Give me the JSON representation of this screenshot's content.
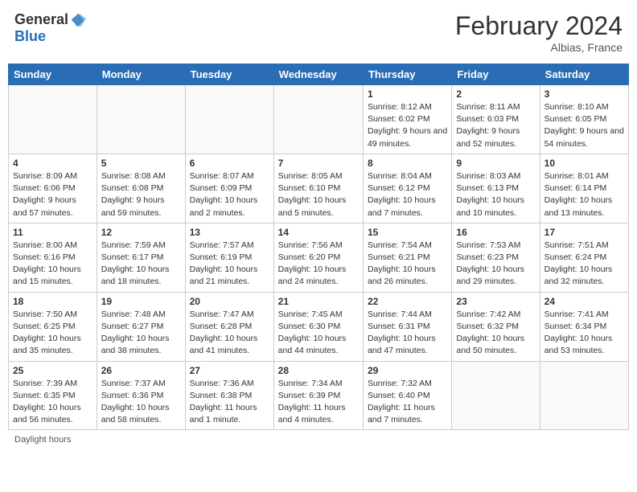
{
  "header": {
    "logo_general": "General",
    "logo_blue": "Blue",
    "month_year": "February 2024",
    "location": "Albias, France"
  },
  "days_of_week": [
    "Sunday",
    "Monday",
    "Tuesday",
    "Wednesday",
    "Thursday",
    "Friday",
    "Saturday"
  ],
  "weeks": [
    [
      {
        "day": "",
        "info": ""
      },
      {
        "day": "",
        "info": ""
      },
      {
        "day": "",
        "info": ""
      },
      {
        "day": "",
        "info": ""
      },
      {
        "day": "1",
        "info": "Sunrise: 8:12 AM\nSunset: 6:02 PM\nDaylight: 9 hours and 49 minutes."
      },
      {
        "day": "2",
        "info": "Sunrise: 8:11 AM\nSunset: 6:03 PM\nDaylight: 9 hours and 52 minutes."
      },
      {
        "day": "3",
        "info": "Sunrise: 8:10 AM\nSunset: 6:05 PM\nDaylight: 9 hours and 54 minutes."
      }
    ],
    [
      {
        "day": "4",
        "info": "Sunrise: 8:09 AM\nSunset: 6:06 PM\nDaylight: 9 hours and 57 minutes."
      },
      {
        "day": "5",
        "info": "Sunrise: 8:08 AM\nSunset: 6:08 PM\nDaylight: 9 hours and 59 minutes."
      },
      {
        "day": "6",
        "info": "Sunrise: 8:07 AM\nSunset: 6:09 PM\nDaylight: 10 hours and 2 minutes."
      },
      {
        "day": "7",
        "info": "Sunrise: 8:05 AM\nSunset: 6:10 PM\nDaylight: 10 hours and 5 minutes."
      },
      {
        "day": "8",
        "info": "Sunrise: 8:04 AM\nSunset: 6:12 PM\nDaylight: 10 hours and 7 minutes."
      },
      {
        "day": "9",
        "info": "Sunrise: 8:03 AM\nSunset: 6:13 PM\nDaylight: 10 hours and 10 minutes."
      },
      {
        "day": "10",
        "info": "Sunrise: 8:01 AM\nSunset: 6:14 PM\nDaylight: 10 hours and 13 minutes."
      }
    ],
    [
      {
        "day": "11",
        "info": "Sunrise: 8:00 AM\nSunset: 6:16 PM\nDaylight: 10 hours and 15 minutes."
      },
      {
        "day": "12",
        "info": "Sunrise: 7:59 AM\nSunset: 6:17 PM\nDaylight: 10 hours and 18 minutes."
      },
      {
        "day": "13",
        "info": "Sunrise: 7:57 AM\nSunset: 6:19 PM\nDaylight: 10 hours and 21 minutes."
      },
      {
        "day": "14",
        "info": "Sunrise: 7:56 AM\nSunset: 6:20 PM\nDaylight: 10 hours and 24 minutes."
      },
      {
        "day": "15",
        "info": "Sunrise: 7:54 AM\nSunset: 6:21 PM\nDaylight: 10 hours and 26 minutes."
      },
      {
        "day": "16",
        "info": "Sunrise: 7:53 AM\nSunset: 6:23 PM\nDaylight: 10 hours and 29 minutes."
      },
      {
        "day": "17",
        "info": "Sunrise: 7:51 AM\nSunset: 6:24 PM\nDaylight: 10 hours and 32 minutes."
      }
    ],
    [
      {
        "day": "18",
        "info": "Sunrise: 7:50 AM\nSunset: 6:25 PM\nDaylight: 10 hours and 35 minutes."
      },
      {
        "day": "19",
        "info": "Sunrise: 7:48 AM\nSunset: 6:27 PM\nDaylight: 10 hours and 38 minutes."
      },
      {
        "day": "20",
        "info": "Sunrise: 7:47 AM\nSunset: 6:28 PM\nDaylight: 10 hours and 41 minutes."
      },
      {
        "day": "21",
        "info": "Sunrise: 7:45 AM\nSunset: 6:30 PM\nDaylight: 10 hours and 44 minutes."
      },
      {
        "day": "22",
        "info": "Sunrise: 7:44 AM\nSunset: 6:31 PM\nDaylight: 10 hours and 47 minutes."
      },
      {
        "day": "23",
        "info": "Sunrise: 7:42 AM\nSunset: 6:32 PM\nDaylight: 10 hours and 50 minutes."
      },
      {
        "day": "24",
        "info": "Sunrise: 7:41 AM\nSunset: 6:34 PM\nDaylight: 10 hours and 53 minutes."
      }
    ],
    [
      {
        "day": "25",
        "info": "Sunrise: 7:39 AM\nSunset: 6:35 PM\nDaylight: 10 hours and 56 minutes."
      },
      {
        "day": "26",
        "info": "Sunrise: 7:37 AM\nSunset: 6:36 PM\nDaylight: 10 hours and 58 minutes."
      },
      {
        "day": "27",
        "info": "Sunrise: 7:36 AM\nSunset: 6:38 PM\nDaylight: 11 hours and 1 minute."
      },
      {
        "day": "28",
        "info": "Sunrise: 7:34 AM\nSunset: 6:39 PM\nDaylight: 11 hours and 4 minutes."
      },
      {
        "day": "29",
        "info": "Sunrise: 7:32 AM\nSunset: 6:40 PM\nDaylight: 11 hours and 7 minutes."
      },
      {
        "day": "",
        "info": ""
      },
      {
        "day": "",
        "info": ""
      }
    ]
  ],
  "footer": {
    "daylight_hours": "Daylight hours"
  }
}
